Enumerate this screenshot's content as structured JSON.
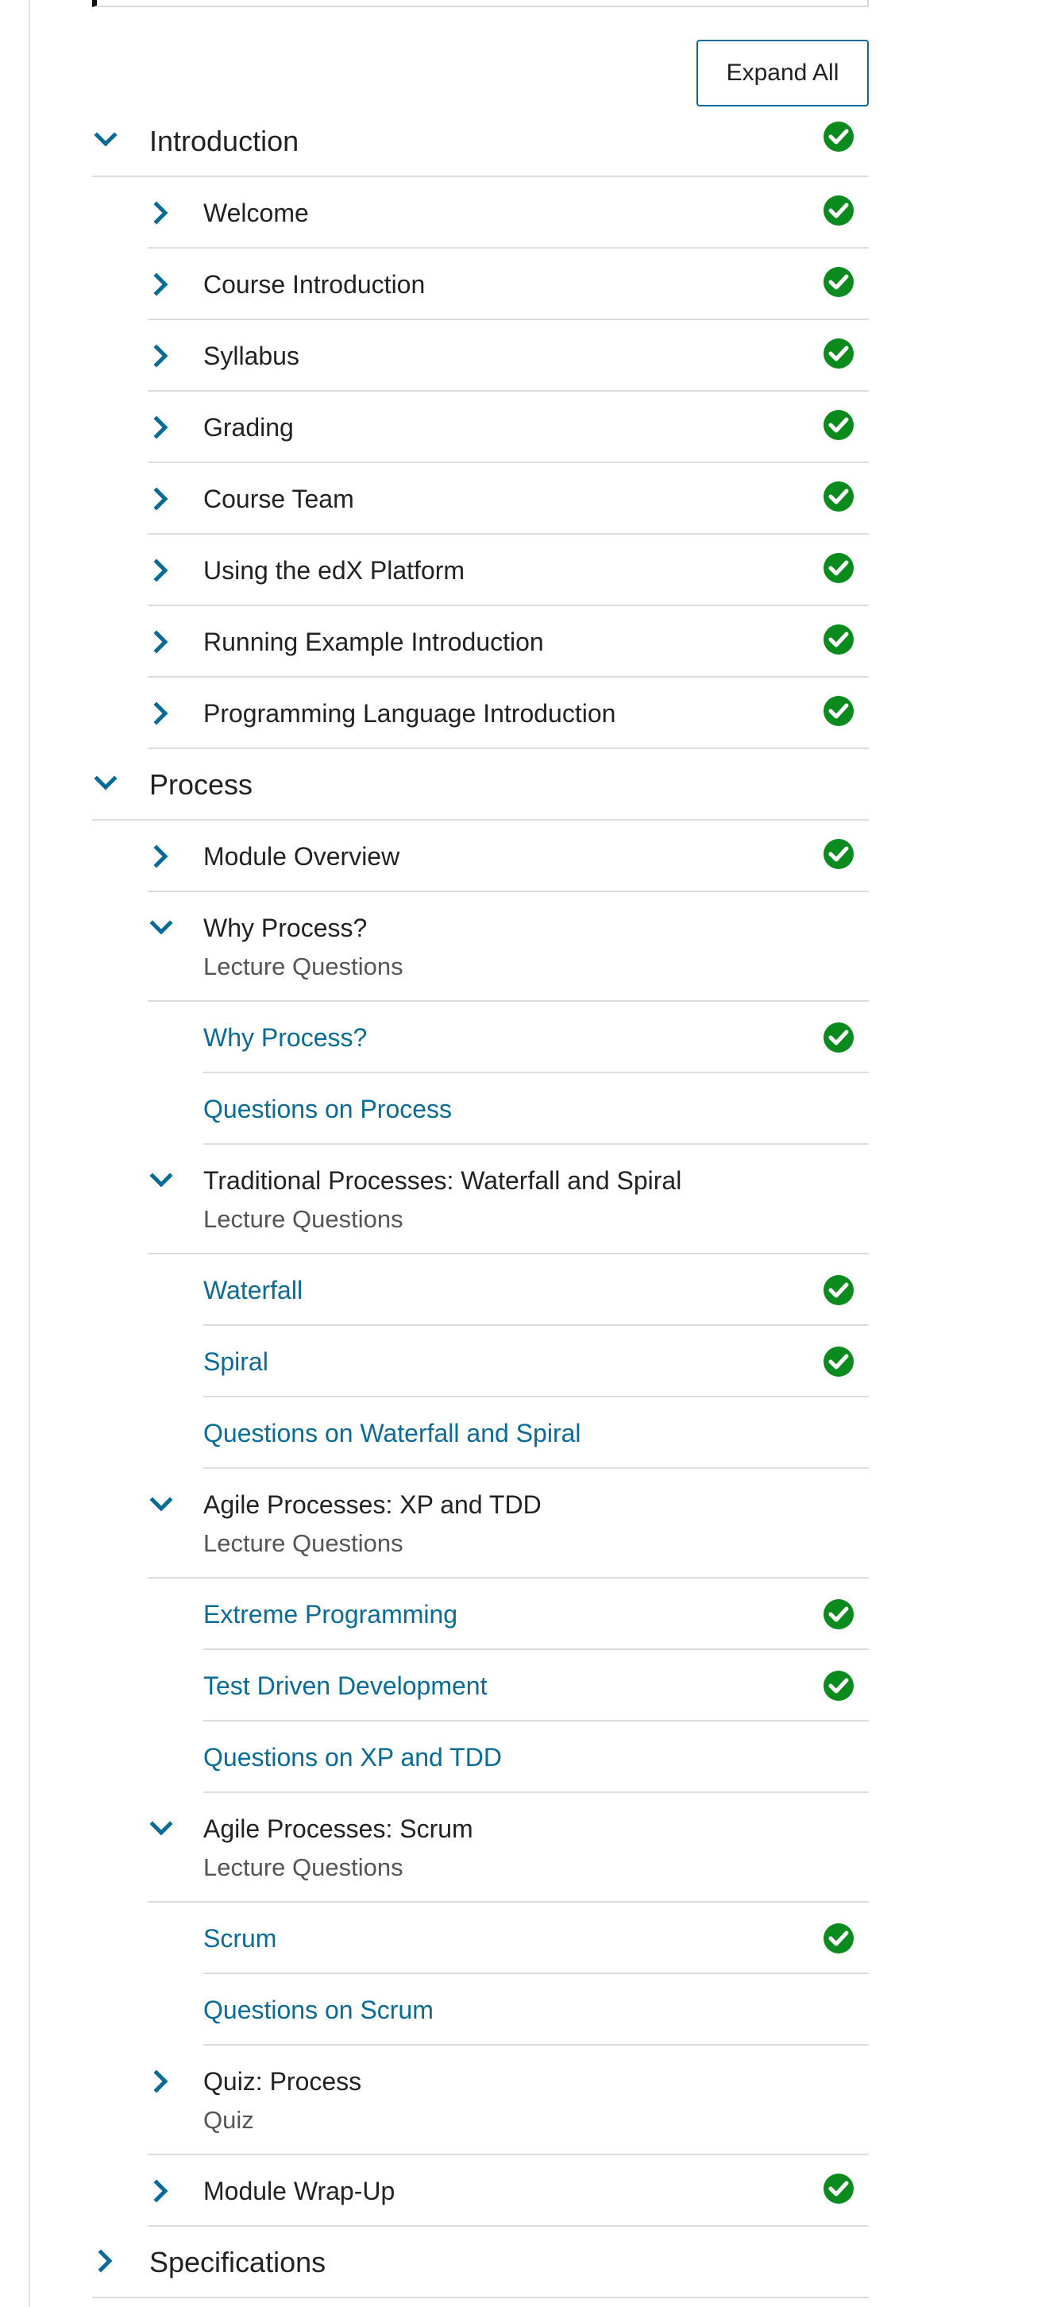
{
  "colors": {
    "accent": "#0a6b96",
    "check": "#0b8a1e",
    "text": "#222222",
    "muted": "#555555",
    "divider": "#dcdcdc"
  },
  "toolbar": {
    "expand_all_label": "Expand All"
  },
  "sections": [
    {
      "title": "Introduction",
      "expanded": true,
      "completed": true,
      "subsections": [
        {
          "title": "Welcome",
          "completed": true,
          "expanded": false
        },
        {
          "title": "Course Introduction",
          "completed": true,
          "expanded": false
        },
        {
          "title": "Syllabus",
          "completed": true,
          "expanded": false
        },
        {
          "title": "Grading",
          "completed": true,
          "expanded": false
        },
        {
          "title": "Course Team",
          "completed": true,
          "expanded": false
        },
        {
          "title": "Using the edX Platform",
          "completed": true,
          "expanded": false
        },
        {
          "title": "Running Example Introduction",
          "completed": true,
          "expanded": false
        },
        {
          "title": "Programming Language Introduction",
          "completed": true,
          "expanded": false
        }
      ]
    },
    {
      "title": "Process",
      "expanded": true,
      "completed": false,
      "subsections": [
        {
          "title": "Module Overview",
          "completed": true,
          "expanded": false
        },
        {
          "title": "Why Process?",
          "subtitle": "Lecture Questions",
          "completed": false,
          "expanded": true,
          "units": [
            {
              "title": "Why Process?",
              "completed": true
            },
            {
              "title": "Questions on Process",
              "completed": false
            }
          ]
        },
        {
          "title": "Traditional Processes: Waterfall and Spiral",
          "subtitle": "Lecture Questions",
          "completed": false,
          "expanded": true,
          "units": [
            {
              "title": "Waterfall",
              "completed": true
            },
            {
              "title": "Spiral",
              "completed": true
            },
            {
              "title": "Questions on Waterfall and Spiral",
              "completed": false
            }
          ]
        },
        {
          "title": "Agile Processes: XP and TDD",
          "subtitle": "Lecture Questions",
          "completed": false,
          "expanded": true,
          "units": [
            {
              "title": "Extreme Programming",
              "completed": true
            },
            {
              "title": "Test Driven Development",
              "completed": true
            },
            {
              "title": "Questions on XP and TDD",
              "completed": false
            }
          ]
        },
        {
          "title": "Agile Processes: Scrum",
          "subtitle": "Lecture Questions",
          "completed": false,
          "expanded": true,
          "units": [
            {
              "title": "Scrum",
              "completed": true
            },
            {
              "title": "Questions on Scrum",
              "completed": false
            }
          ]
        },
        {
          "title": "Quiz: Process",
          "subtitle": "Quiz",
          "completed": false,
          "expanded": false
        },
        {
          "title": "Module Wrap-Up",
          "completed": true,
          "expanded": false
        }
      ]
    },
    {
      "title": "Specifications",
      "expanded": false,
      "completed": false,
      "subsections": []
    }
  ],
  "icons": {
    "expanded": "chevron-down-icon",
    "collapsed": "chevron-right-icon",
    "completed": "check-circle-icon"
  }
}
